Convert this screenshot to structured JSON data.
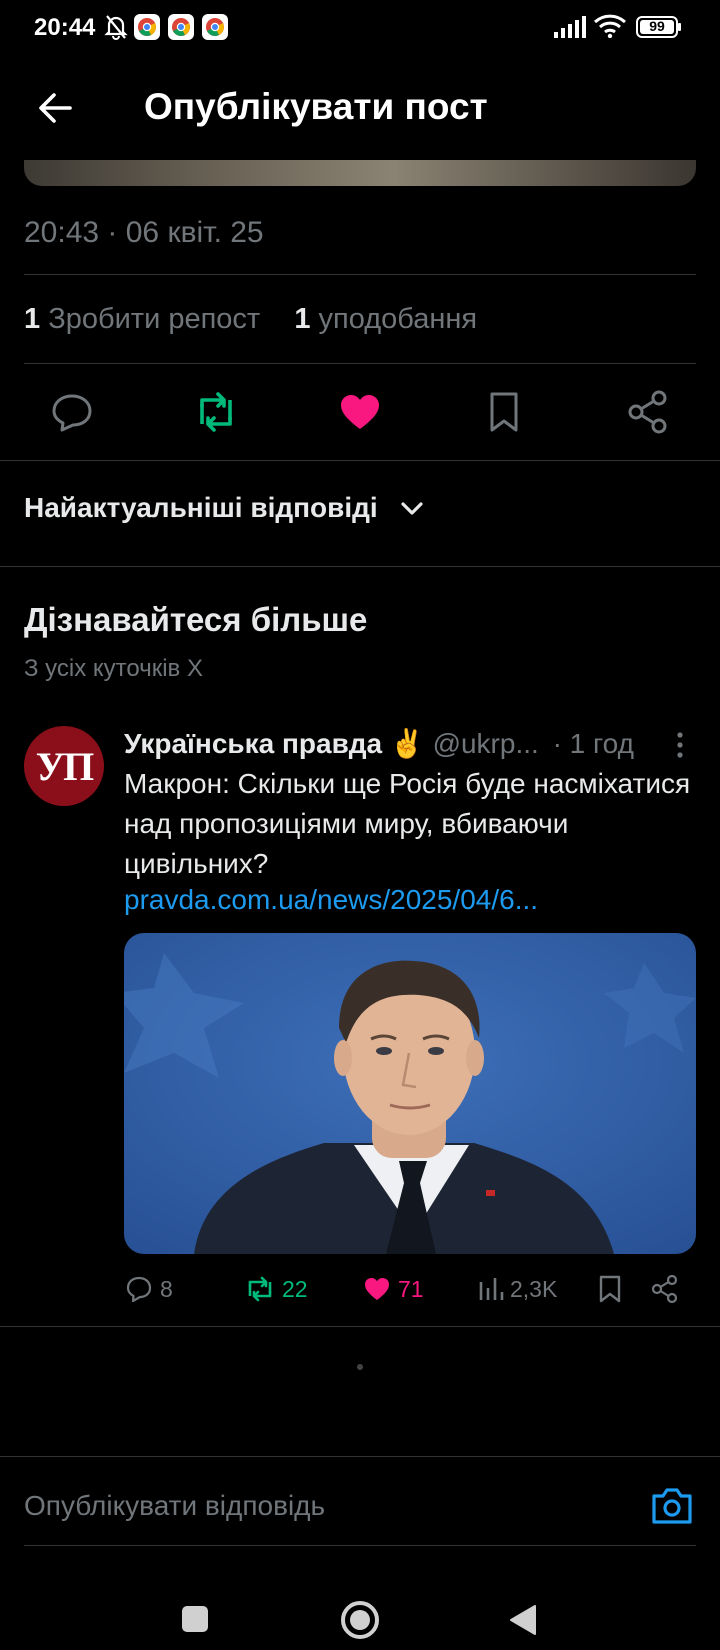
{
  "status_bar": {
    "time": "20:44",
    "battery": "99",
    "icons": [
      "bell-muted-icon",
      "chrome-icon",
      "chrome-icon",
      "chrome-icon",
      "signal-icon",
      "wifi-icon",
      "battery-icon"
    ]
  },
  "header": {
    "title": "Опублікувати пост",
    "back_icon": "arrow-left-icon"
  },
  "post": {
    "timestamp": "20:43 · 06 квіт. 25",
    "reposts_count": "1",
    "reposts_label": "Зробити репост",
    "likes_count": "1",
    "likes_label": "уподобання",
    "actions": [
      "reply-icon",
      "repost-icon",
      "like-icon",
      "bookmark-icon",
      "share-icon"
    ],
    "colors": {
      "repost": "#00ba7c",
      "like": "#f91880"
    }
  },
  "replies": {
    "sort_label": "Найактуальніші відповіді"
  },
  "discover": {
    "title": "Дізнавайтеся більше",
    "subtitle": "З усіх куточків X"
  },
  "tweet": {
    "avatar_text": "УП",
    "author": "Українська правда",
    "emoji": "✌️",
    "handle": "@ukrp...",
    "time": "· 1 год",
    "text": "Макрон: Скільки ще Росія буде насміхатися над пропозиціями миру, вбиваючи цивільних?",
    "link": "pravda.com.ua/news/2025/04/6...",
    "replies": "8",
    "reposts": "22",
    "likes": "71",
    "views": "2,3K"
  },
  "composer": {
    "placeholder": "Опублікувати відповідь"
  },
  "colors": {
    "background": "#000000",
    "text": "#e7e9ea",
    "muted": "#71767b",
    "link": "#1d9bf0",
    "divider": "#2f3336",
    "avatar_bg": "#8b0f1a"
  }
}
